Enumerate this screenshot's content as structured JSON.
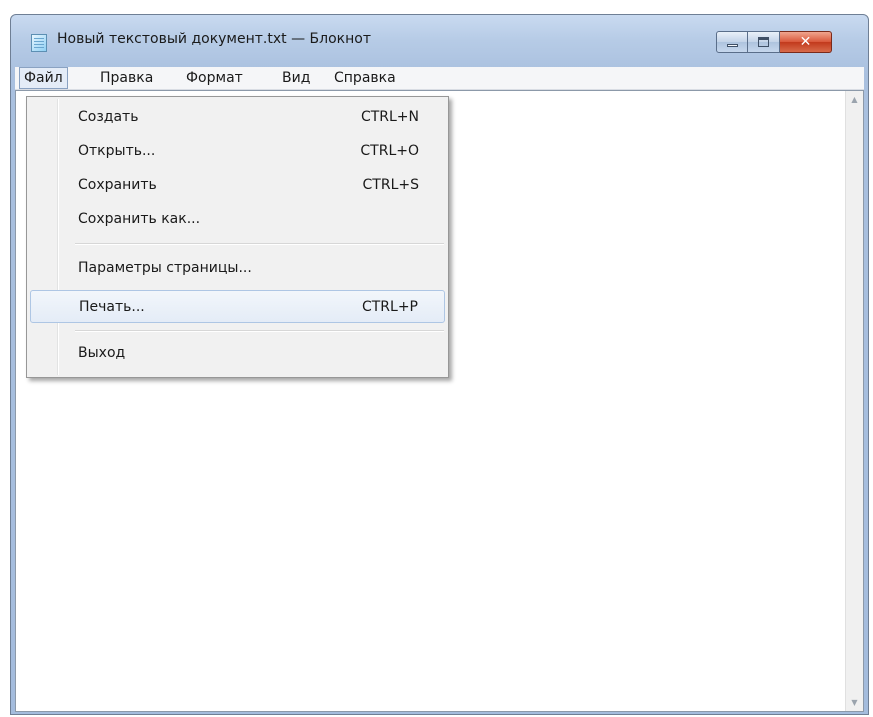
{
  "window": {
    "title": "Новый текстовый документ.txt — Блокнот",
    "close_glyph": "✕"
  },
  "menubar": {
    "items": [
      {
        "label": "Файл"
      },
      {
        "label": "Правка"
      },
      {
        "label": "Формат"
      },
      {
        "label": "Вид"
      },
      {
        "label": "Справка"
      }
    ]
  },
  "file_menu": {
    "items": [
      {
        "label": "Создать",
        "shortcut": "CTRL+N"
      },
      {
        "label": "Открыть...",
        "shortcut": "CTRL+O"
      },
      {
        "label": "Сохранить",
        "shortcut": "CTRL+S"
      },
      {
        "label": "Сохранить как...",
        "shortcut": ""
      },
      {
        "label": "Параметры страницы...",
        "shortcut": ""
      },
      {
        "label": "Печать...",
        "shortcut": "CTRL+P"
      },
      {
        "label": "Выход",
        "shortcut": ""
      }
    ],
    "highlighted_item": "Печать..."
  },
  "scrollbar": {
    "up_glyph": "▲",
    "down_glyph": "▼"
  },
  "icons": {
    "app": "notepad-icon",
    "minimize": "minimize-icon",
    "maximize": "maximize-icon",
    "close": "close-icon"
  },
  "colors": {
    "titlebar": "#b6cbe6",
    "close_button": "#c2391c",
    "menu_highlight": "#e4ecf7"
  }
}
